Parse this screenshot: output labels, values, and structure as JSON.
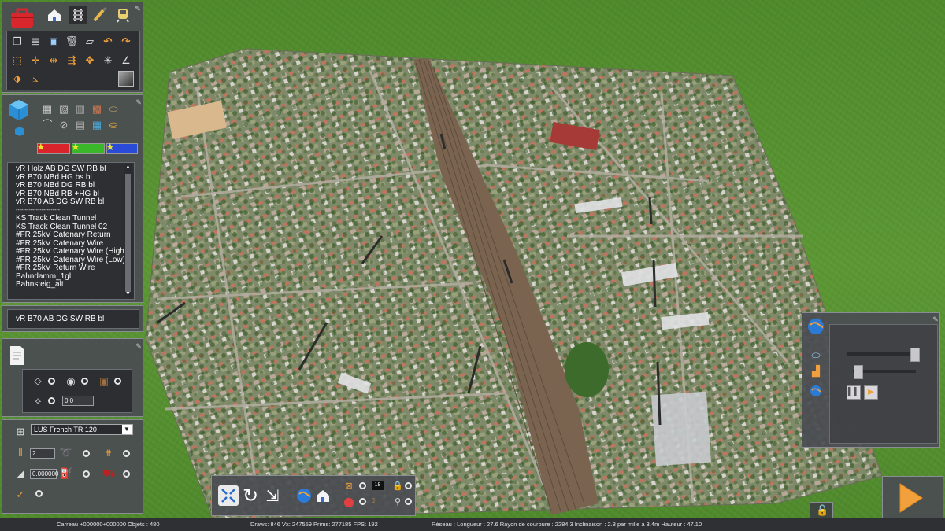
{
  "toolbar_top": {
    "icons": [
      "toolbox-icon",
      "house-icon",
      "rail-icon",
      "paintbrush-icon",
      "train-icon",
      "pin-icon"
    ]
  },
  "tools": {
    "rows": [
      [
        "copy-icon",
        "paste-icon",
        "monitor-icon",
        "delete-icon",
        "eraser-icon",
        "undo-icon",
        "redo-icon"
      ],
      [
        "select-box-icon",
        "move-icon",
        "split-icon",
        "join-icon",
        "rotate-icon",
        "align-icon",
        "angle-icon"
      ],
      [
        "ruler-icon",
        "measure-icon"
      ]
    ]
  },
  "object_palette": {
    "color_buttons": [
      "red",
      "green",
      "blue"
    ],
    "items": [
      "vR Holz AB DG SW RB bl",
      "vR B70 NBd HG bs bl",
      "vR B70 NBd DG RB bl",
      "vR B70 NBd RB +HG bl",
      "vR B70 AB DG SW RB bl",
      "------------------------",
      " KS Track Clean Tunnel",
      " KS Track Clean Tunnel 02",
      "#FR 25kV Catenary Return",
      "#FR 25kV Catenary Wire",
      "#FR 25kV Catenary Wire (High)",
      "#FR 25kV Catenary Wire (Low)",
      "#FR 25kV Return Wire",
      "Bahndamm_1gl",
      "Bahnsteig_alt"
    ],
    "selected": "vR B70 AB DG SW RB bl"
  },
  "props_panel": {
    "height_value": "0.0"
  },
  "track_panel": {
    "track_type": "LUS French TR 120",
    "count_value": "2",
    "gradient_value": "0.000000"
  },
  "bottom_toolbar": {
    "value_a": "18"
  },
  "right_panel": {
    "play_label": "▶"
  },
  "status_bar": {
    "carreau": "Carreau  +000000+000000  Objets : 480",
    "draws": "Draws: 846 Vx: 247559 Prims: 277185 FPS: 192",
    "reseau": "Réseau :  Longueur : 27.6 Rayon de courbure : 2284.3 Inclinaison : 2.8 par mille à 3.4m Hauteur : 47.10"
  },
  "colors": {
    "panel": "#4a4c52",
    "accent_orange": "#f2a03c",
    "list_text": "#ffffff"
  }
}
